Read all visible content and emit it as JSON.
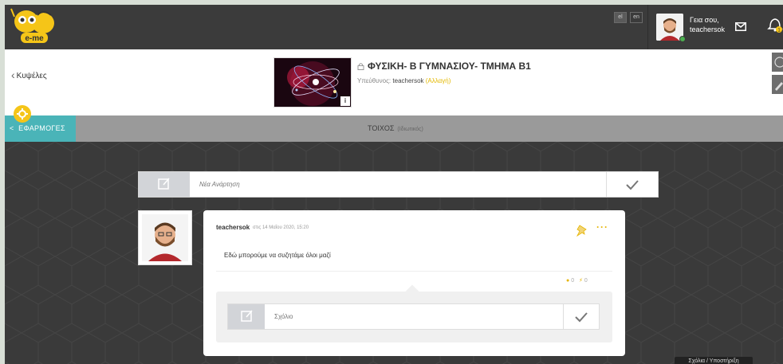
{
  "app": {
    "logo_text": "e-me"
  },
  "languages": [
    {
      "code": "el",
      "active": true
    },
    {
      "code": "en",
      "active": false
    }
  ],
  "user": {
    "greeting": "Γεια σου,",
    "username": "teachersok"
  },
  "notifications": {
    "count": "1"
  },
  "course": {
    "back_label": "Κυψέλες",
    "title": "ΦΥΣΙΚΗ- Β ΓΥΜΝΑΣΙΟΥ- ΤΜΗΜΑ Β1",
    "owner_label": "Υπεύθυνος:",
    "owner_name": "teachersok",
    "change_label": "(Αλλαγή)",
    "info_label": "i"
  },
  "apps_bar": {
    "apps_label": "ΕΦΑΡΜΟΓΕΣ",
    "wall_label": "ΤΟΙΧΟΣ",
    "wall_sub": "(Ιδιωτικός)"
  },
  "new_post": {
    "placeholder": "Νέα Ανάρτηση"
  },
  "posts": [
    {
      "author": "teachersok",
      "date": "στις 14 Μαΐου 2020, 15:20",
      "body": "Εδώ μπορούμε να συζητάμε όλοι μαζί",
      "comments_count": "0",
      "likes_count": "0",
      "more_label": "···",
      "comment_placeholder": "Σχόλιο"
    }
  ],
  "help_chip": "Σχόλια / Υποστήριξη",
  "colors": {
    "accent_teal": "#4ab4b8",
    "accent_yellow": "#f5c518",
    "topbar": "#3b3b3b"
  }
}
